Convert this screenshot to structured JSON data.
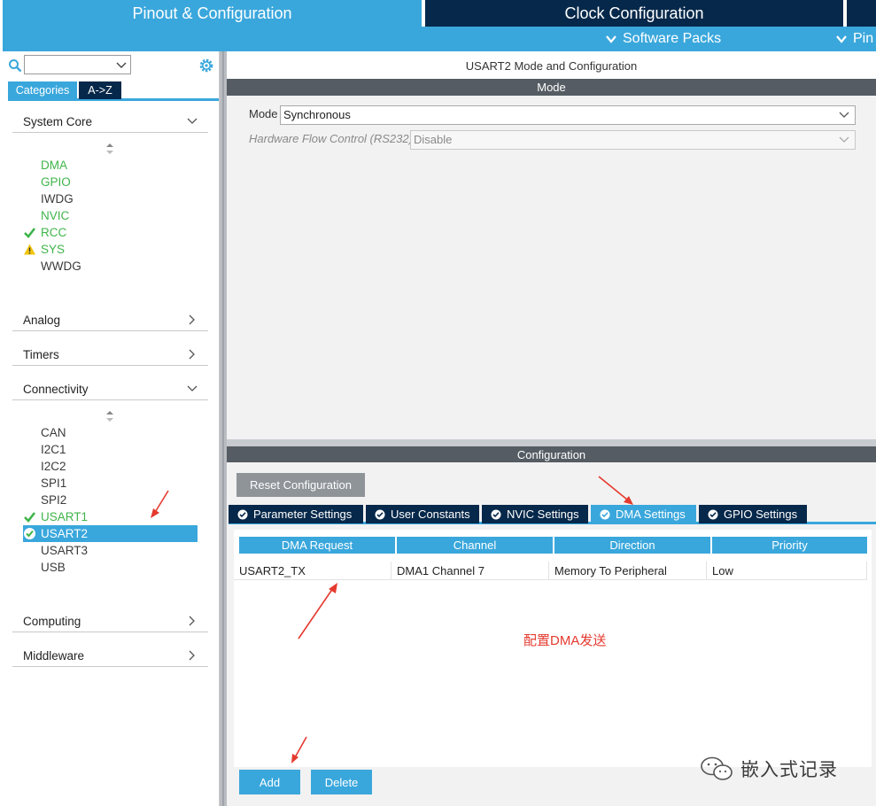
{
  "header": {
    "tabs": [
      {
        "label": "Pinout & Configuration",
        "active": true
      },
      {
        "label": "Clock Configuration",
        "active": false
      }
    ],
    "sub_items": [
      {
        "label": "Software Packs"
      },
      {
        "label": "Pin"
      }
    ]
  },
  "sidebar": {
    "search": {
      "value": "",
      "placeholder": ""
    },
    "tabs": [
      {
        "label": "Categories",
        "active": true
      },
      {
        "label": "A->Z",
        "active": false
      }
    ],
    "sections": {
      "system_core": {
        "label": "System Core",
        "expanded": true,
        "items": [
          {
            "label": "DMA",
            "status": "configured"
          },
          {
            "label": "GPIO",
            "status": "configured"
          },
          {
            "label": "IWDG",
            "status": "none"
          },
          {
            "label": "NVIC",
            "status": "configured"
          },
          {
            "label": "RCC",
            "status": "ok"
          },
          {
            "label": "SYS",
            "status": "warning"
          },
          {
            "label": "WWDG",
            "status": "none"
          }
        ]
      },
      "analog": {
        "label": "Analog",
        "expanded": false
      },
      "timers": {
        "label": "Timers",
        "expanded": false
      },
      "connectivity": {
        "label": "Connectivity",
        "expanded": true,
        "items": [
          {
            "label": "CAN",
            "status": "none"
          },
          {
            "label": "I2C1",
            "status": "none"
          },
          {
            "label": "I2C2",
            "status": "none"
          },
          {
            "label": "SPI1",
            "status": "none"
          },
          {
            "label": "SPI2",
            "status": "none"
          },
          {
            "label": "USART1",
            "status": "ok"
          },
          {
            "label": "USART2",
            "status": "selected"
          },
          {
            "label": "USART3",
            "status": "none"
          },
          {
            "label": "USB",
            "status": "none"
          }
        ]
      },
      "computing": {
        "label": "Computing",
        "expanded": false
      },
      "middleware": {
        "label": "Middleware",
        "expanded": false
      }
    }
  },
  "main": {
    "title": "USART2 Mode and Configuration",
    "mode_bar": "Mode",
    "mode": {
      "label": "Mode",
      "value": "Synchronous"
    },
    "flow_control": {
      "label": "Hardware Flow Control (RS232)",
      "value": "Disable",
      "disabled": true
    },
    "config_bar": "Configuration",
    "reset_button": "Reset Configuration",
    "tabs": [
      {
        "label": "Parameter Settings",
        "active": false
      },
      {
        "label": "User Constants",
        "active": false
      },
      {
        "label": "NVIC Settings",
        "active": false
      },
      {
        "label": "DMA Settings",
        "active": true
      },
      {
        "label": "GPIO Settings",
        "active": false
      }
    ],
    "dma_table": {
      "columns": [
        "DMA Request",
        "Channel",
        "Direction",
        "Priority"
      ],
      "rows": [
        [
          "USART2_TX",
          "DMA1 Channel 7",
          "Memory To Peripheral",
          "Low"
        ]
      ]
    },
    "add_button": "Add",
    "delete_button": "Delete"
  },
  "annotation": {
    "text": "配置DMA发送",
    "color": "#e53a2f"
  },
  "watermark": {
    "text": "嵌入式记录"
  },
  "colors": {
    "accent": "#3aa7dc",
    "navy": "#06284a",
    "dark_bar": "#555c63",
    "ok_green": "#3fb44a",
    "warning_yellow": "#f1c40f"
  }
}
